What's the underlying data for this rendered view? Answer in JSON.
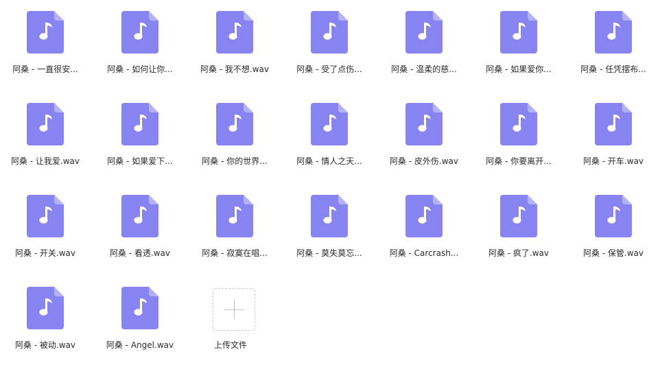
{
  "files": [
    {
      "label": "阿桑 - 一直很安..."
    },
    {
      "label": "阿桑 - 如何让你..."
    },
    {
      "label": "阿桑 - 我不想.wav"
    },
    {
      "label": "阿桑 - 受了点伤..."
    },
    {
      "label": "阿桑 - 温柔的慈..."
    },
    {
      "label": "阿桑 - 如果爱你..."
    },
    {
      "label": "阿桑 - 任凭摆布..."
    },
    {
      "label": "阿桑 - 让我爱.wav"
    },
    {
      "label": "阿桑 - 如果爱下..."
    },
    {
      "label": "阿桑 - 你的世界..."
    },
    {
      "label": "阿桑 - 情人之天..."
    },
    {
      "label": "阿桑 - 皮外伤.wav"
    },
    {
      "label": "阿桑 - 你要离开..."
    },
    {
      "label": "阿桑 - 开车.wav"
    },
    {
      "label": "阿桑 - 开关.wav"
    },
    {
      "label": "阿桑 - 看透.wav"
    },
    {
      "label": "阿桑 - 寂寞在唱..."
    },
    {
      "label": "阿桑 - 莫失莫忘..."
    },
    {
      "label": "阿桑 - Carcrash..."
    },
    {
      "label": "阿桑 - 疯了.wav"
    },
    {
      "label": "阿桑 - 保管.wav"
    },
    {
      "label": "阿桑 - 被动.wav"
    },
    {
      "label": "阿桑 - Angel.wav"
    }
  ],
  "upload": {
    "label": "上传文件"
  },
  "colors": {
    "file_icon": "#8784f2",
    "file_icon_fold": "#b4b2f7",
    "note": "#ffffff",
    "upload_border": "#c8c8c8"
  },
  "icons": {
    "file": "music-file-icon",
    "upload": "plus-icon"
  }
}
